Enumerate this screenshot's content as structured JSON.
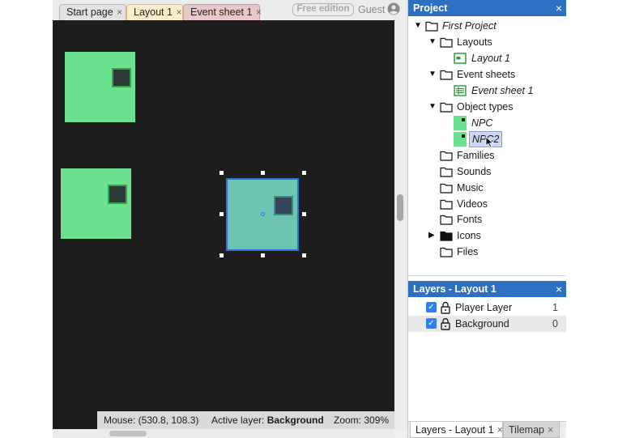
{
  "editor": {
    "tabs": [
      {
        "label": "Start page"
      },
      {
        "label": "Layout 1"
      },
      {
        "label": "Event sheet 1"
      }
    ],
    "tab_close_glyph": "×",
    "free_edition_label": "Free edition",
    "guest_label": "Guest",
    "status": {
      "mouse_label": "Mouse: (530.8, 108.3)",
      "active_layer_prefix": "Active layer:",
      "active_layer_value": "Background",
      "zoom_label": "Zoom: 309%"
    }
  },
  "project_panel": {
    "title": "Project",
    "close_glyph": "×",
    "tree": [
      {
        "label": "First Project",
        "icon": "folder-icon",
        "expanded": true
      },
      {
        "label": "Layouts",
        "icon": "folder-icon",
        "expanded": true
      },
      {
        "label": "Layout 1",
        "icon": "layout-icon"
      },
      {
        "label": "Event sheets",
        "icon": "folder-icon",
        "expanded": true
      },
      {
        "label": "Event sheet 1",
        "icon": "event-sheet-icon"
      },
      {
        "label": "Object types",
        "icon": "folder-icon",
        "expanded": true
      },
      {
        "label": "NPC",
        "icon": "sprite-icon"
      },
      {
        "label": "NPC2",
        "icon": "sprite-icon",
        "selected": true
      },
      {
        "label": "Families",
        "icon": "folder-icon"
      },
      {
        "label": "Sounds",
        "icon": "folder-icon"
      },
      {
        "label": "Music",
        "icon": "folder-icon"
      },
      {
        "label": "Videos",
        "icon": "folder-icon"
      },
      {
        "label": "Fonts",
        "icon": "folder-icon"
      },
      {
        "label": "Icons",
        "icon": "folder-filled-icon",
        "expanded": false
      },
      {
        "label": "Files",
        "icon": "folder-icon"
      }
    ]
  },
  "layers_panel": {
    "title": "Layers - Layout 1",
    "close_glyph": "×",
    "layers": [
      {
        "name": "Player Layer",
        "index": "1",
        "visible": true
      },
      {
        "name": "Background",
        "index": "0",
        "visible": true
      }
    ]
  },
  "bottom_tabs": [
    {
      "label": "Layers - Layout 1"
    },
    {
      "label": "Tilemap"
    }
  ],
  "colors": {
    "accent": "#2f6fc2",
    "sprite_green": "#6ce18f",
    "selection_blue": "#2f6fd8",
    "canvas_bg": "#1d1d1d"
  }
}
